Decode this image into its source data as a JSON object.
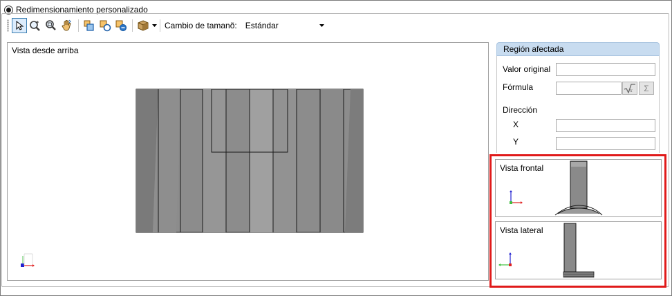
{
  "title": "Redimensionamiento personalizado",
  "toolbar": {
    "tools": [
      {
        "name": "select-tool",
        "icon": "cursor-icon"
      },
      {
        "name": "zoom-tool",
        "icon": "zoom-icon"
      },
      {
        "name": "zoom-fit-tool",
        "icon": "zoom-fit-icon"
      },
      {
        "name": "pan-tool",
        "icon": "hand-icon"
      }
    ],
    "resize_label": "Cambio de tamanõ:",
    "resize_value": "Estándar"
  },
  "top_view": {
    "label": "Vista desde arriba"
  },
  "region": {
    "header": "Región afectada",
    "original_value_label": "Valor original",
    "formula_label": "Fórmula",
    "direction_label": "Dirección",
    "x_label": "X",
    "y_label": "Y",
    "sum_symbol": "Σ"
  },
  "front_view": {
    "label": "Vista frontal"
  },
  "side_view": {
    "label": "Vista lateral"
  },
  "colors": {
    "highlight": "#e01a1a",
    "header": "#c8dcf0",
    "slab": "#8a8a8a",
    "axis_x": "#e02020",
    "axis_y": "#40c040",
    "axis_z": "#2020d0"
  }
}
